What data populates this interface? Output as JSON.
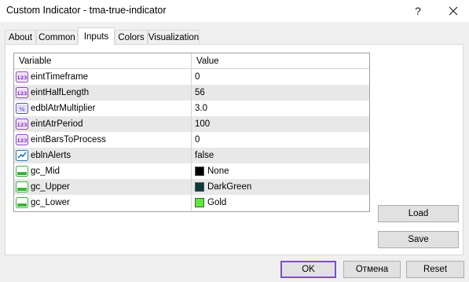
{
  "window": {
    "title": "Custom Indicator - tma-true-indicator",
    "help_glyph": "?",
    "close_icon": "close-icon"
  },
  "tabs": [
    {
      "label": "About",
      "active": false
    },
    {
      "label": "Common",
      "active": false
    },
    {
      "label": "Inputs",
      "active": true
    },
    {
      "label": "Colors",
      "active": false
    },
    {
      "label": "Visualization",
      "active": false
    }
  ],
  "table": {
    "headers": {
      "variable": "Variable",
      "value": "Value"
    },
    "rows": [
      {
        "icon": "int-icon",
        "name": "eintTimeframe",
        "value": "0"
      },
      {
        "icon": "int-icon",
        "name": "eintHalfLength",
        "value": "56"
      },
      {
        "icon": "double-icon",
        "name": "edblAtrMultiplier",
        "value": "3.0"
      },
      {
        "icon": "int-icon",
        "name": "eintAtrPeriod",
        "value": "100"
      },
      {
        "icon": "int-icon",
        "name": "eintBarsToProcess",
        "value": "0"
      },
      {
        "icon": "bool-icon",
        "name": "eblnAlerts",
        "value": "false"
      },
      {
        "icon": "color-icon",
        "name": "gc_Mid",
        "value": "None",
        "swatch": "#000000"
      },
      {
        "icon": "color-icon",
        "name": "gc_Upper",
        "value": "DarkGreen",
        "swatch": "#0d3b3b"
      },
      {
        "icon": "color-icon",
        "name": "gc_Lower",
        "value": "Gold",
        "swatch": "#5aea3a"
      }
    ]
  },
  "side_buttons": {
    "load": "Load",
    "save": "Save"
  },
  "bottom_buttons": {
    "ok": "OK",
    "cancel": "Отмена",
    "reset": "Reset"
  },
  "colors": {
    "ok_border": "#7e4ec8",
    "int_icon": "#8a3bbf",
    "double_icon": "#5a48c8",
    "bool_icon": "#2a7aa8",
    "color_icon": "#3bb33b"
  }
}
